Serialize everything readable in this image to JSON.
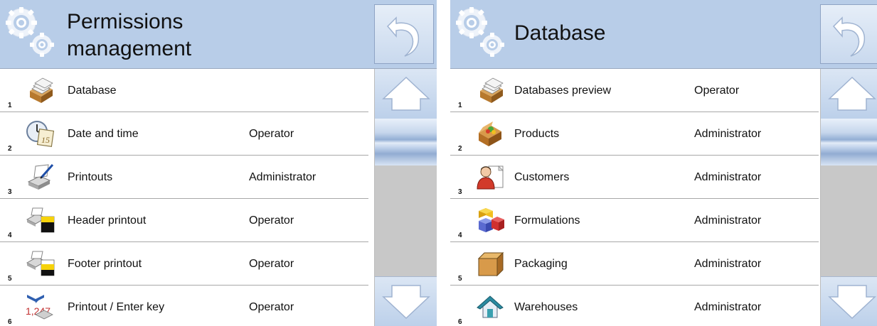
{
  "left_panel": {
    "title": "Permissions management",
    "title_line1": "Permissions",
    "title_line2": "management",
    "rows": [
      {
        "num": "1",
        "name": "Database",
        "perm": "",
        "icon": "database-icon"
      },
      {
        "num": "2",
        "name": "Date and time",
        "perm": "Operator",
        "icon": "calendar-clock-icon"
      },
      {
        "num": "3",
        "name": "Printouts",
        "perm": "Administrator",
        "icon": "printer-edit-icon"
      },
      {
        "num": "4",
        "name": "Header printout",
        "perm": "Operator",
        "icon": "header-printout-icon"
      },
      {
        "num": "5",
        "name": "Footer printout",
        "perm": "Operator",
        "icon": "footer-printout-icon"
      },
      {
        "num": "6",
        "name": "Printout / Enter key",
        "perm": "Operator",
        "icon": "printout-enter-key-icon",
        "icon_text": "1,247"
      }
    ]
  },
  "right_panel": {
    "title": "Database",
    "rows": [
      {
        "num": "1",
        "name": "Databases preview",
        "perm": "Operator",
        "icon": "database-icon"
      },
      {
        "num": "2",
        "name": "Products",
        "perm": "Administrator",
        "icon": "products-box-icon"
      },
      {
        "num": "3",
        "name": "Customers",
        "perm": "Administrator",
        "icon": "customers-icon"
      },
      {
        "num": "4",
        "name": "Formulations",
        "perm": "Administrator",
        "icon": "formulations-cubes-icon"
      },
      {
        "num": "5",
        "name": "Packaging",
        "perm": "Administrator",
        "icon": "packaging-box-icon"
      },
      {
        "num": "6",
        "name": "Warehouses",
        "perm": "Administrator",
        "icon": "warehouse-house-icon"
      }
    ]
  },
  "icons": {
    "settings": "gears-icon",
    "back": "back-arrow-icon",
    "scroll_up": "arrow-up-icon",
    "scroll_down": "arrow-down-icon"
  },
  "colors": {
    "header_bg": "#b8cde8",
    "button_bg": "#c9d9ee",
    "scrollbar_track": "#c8c8c8",
    "separator": "#a8a8a8"
  }
}
